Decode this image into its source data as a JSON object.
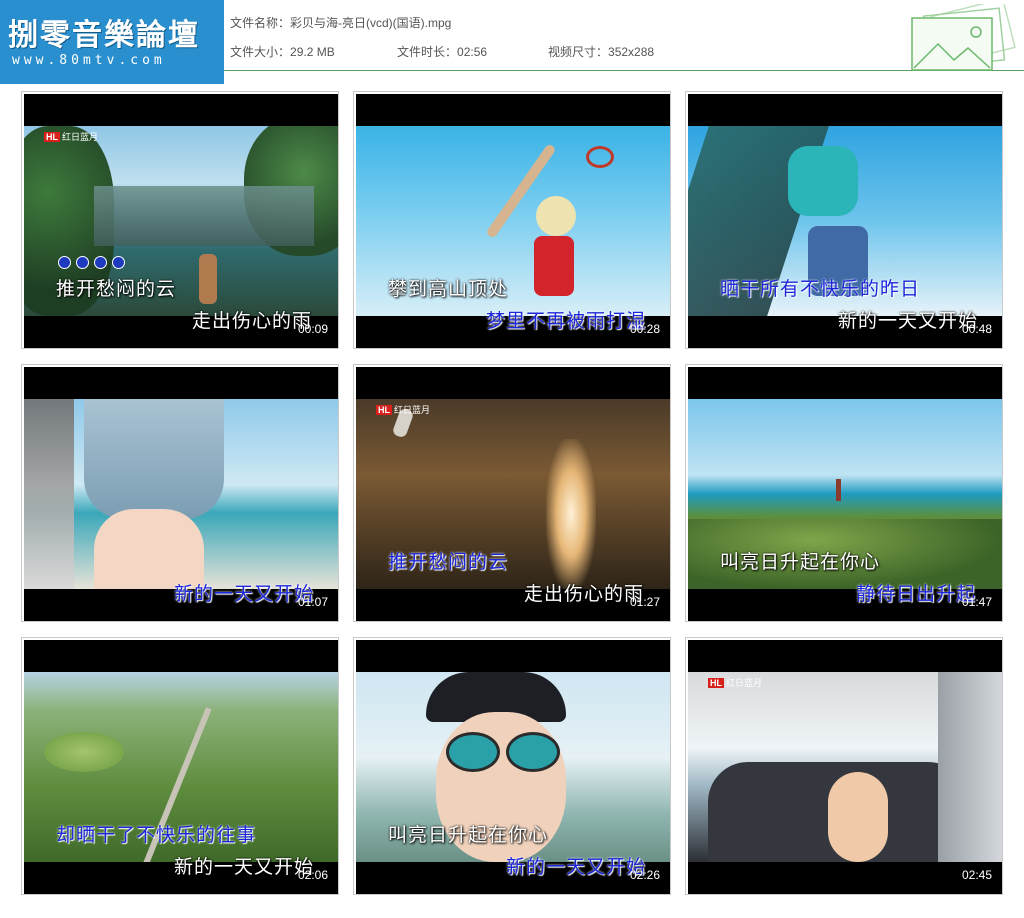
{
  "logo": {
    "text": "捌零音樂論壇",
    "url": "www.80mtv.com"
  },
  "file": {
    "name_label": "文件名称：",
    "name_value": "彩贝与海-亮日(vcd)(国语).mpg",
    "size_label": "文件大小：",
    "size_value": "29.2 MB",
    "duration_label": "文件时长：",
    "duration_value": "02:56",
    "dimensions_label": "视频尺寸：",
    "dimensions_value": "352x288"
  },
  "thumbnails": [
    {
      "time": "00:09",
      "line1": "推开愁闷的云",
      "line2": "走出伤心的雨",
      "logo": "红日蓝月"
    },
    {
      "time": "00:28",
      "line1": "攀到高山顶处",
      "line2": "梦里不再被雨打湿"
    },
    {
      "time": "00:48",
      "line1": "晒干所有不快乐的昨日",
      "line2": "新的一天又开始"
    },
    {
      "time": "01:07",
      "line1": "新的一天又开始"
    },
    {
      "time": "01:27",
      "line1": "推开愁闷的云",
      "line2": "走出伤心的雨",
      "logo": "红日蓝月"
    },
    {
      "time": "01:47",
      "line1": "叫亮日升起在你心",
      "line2": "静待日出升起"
    },
    {
      "time": "02:06",
      "line1": "却晒干了不快乐的往事",
      "line2": "新的一天又开始"
    },
    {
      "time": "02:26",
      "line1": "叫亮日升起在你心",
      "line2": "新的一天又开始"
    },
    {
      "time": "02:45",
      "logo": "红日蓝月"
    }
  ],
  "colors": {
    "lyric_blue": "#1c27d9",
    "logo_bg": "#2a8fcf",
    "header_line": "#5aa05a"
  }
}
